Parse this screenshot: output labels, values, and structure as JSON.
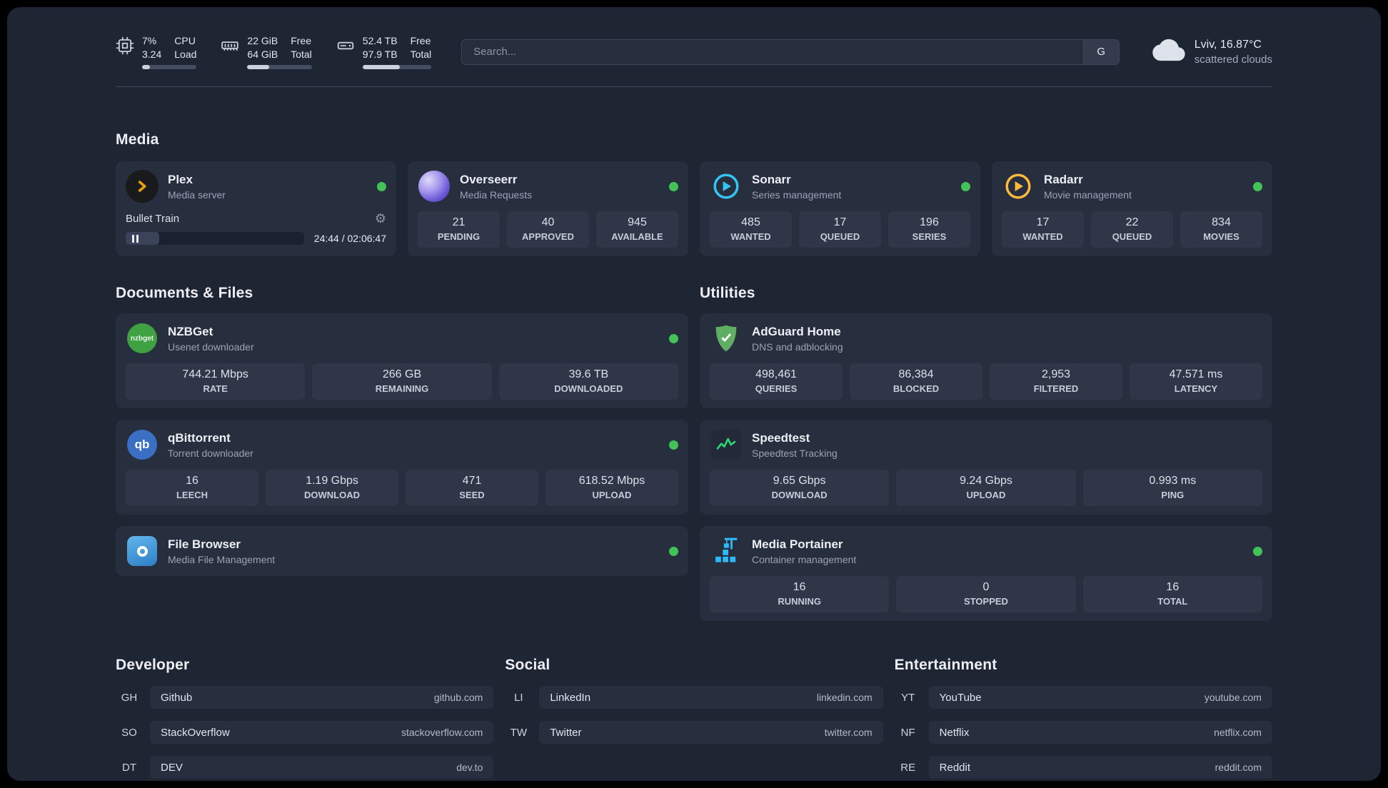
{
  "system": {
    "cpu": {
      "value1": "7%",
      "label1": "CPU",
      "value2": "3.24",
      "label2": "Load",
      "bar_style": "width:15%"
    },
    "ram": {
      "value1": "22 GiB",
      "label1": "Free",
      "value2": "64 GiB",
      "label2": "Total",
      "bar_style": "width:34%"
    },
    "disk": {
      "value1": "52.4 TB",
      "label1": "Free",
      "value2": "97.9 TB",
      "label2": "Total",
      "bar_style": "width:54%"
    }
  },
  "search": {
    "placeholder": "Search...",
    "engine": "G"
  },
  "weather": {
    "location": "Lviv, 16.87°C",
    "condition": "scattered clouds"
  },
  "sections": {
    "media": "Media",
    "documents": "Documents & Files",
    "utilities": "Utilities",
    "developer": "Developer",
    "social": "Social",
    "entertainment": "Entertainment"
  },
  "media": {
    "plex": {
      "name": "Plex",
      "subtitle": "Media server",
      "track": "Bullet Train",
      "time": "24:44 / 02:06:47",
      "seek_style": "width:19%"
    },
    "overseerr": {
      "name": "Overseerr",
      "subtitle": "Media Requests",
      "stats": [
        {
          "value": "21",
          "label": "PENDING"
        },
        {
          "value": "40",
          "label": "APPROVED"
        },
        {
          "value": "945",
          "label": "AVAILABLE"
        }
      ]
    },
    "sonarr": {
      "name": "Sonarr",
      "subtitle": "Series management",
      "stats": [
        {
          "value": "485",
          "label": "WANTED"
        },
        {
          "value": "17",
          "label": "QUEUED"
        },
        {
          "value": "196",
          "label": "SERIES"
        }
      ]
    },
    "radarr": {
      "name": "Radarr",
      "subtitle": "Movie management",
      "stats": [
        {
          "value": "17",
          "label": "WANTED"
        },
        {
          "value": "22",
          "label": "QUEUED"
        },
        {
          "value": "834",
          "label": "MOVIES"
        }
      ]
    }
  },
  "documents": {
    "nzbget": {
      "name": "NZBGet",
      "subtitle": "Usenet downloader",
      "stats": [
        {
          "value": "744.21 Mbps",
          "label": "RATE"
        },
        {
          "value": "266 GB",
          "label": "REMAINING"
        },
        {
          "value": "39.6 TB",
          "label": "DOWNLOADED"
        }
      ]
    },
    "qbittorrent": {
      "name": "qBittorrent",
      "subtitle": "Torrent downloader",
      "stats": [
        {
          "value": "16",
          "label": "LEECH"
        },
        {
          "value": "1.19 Gbps",
          "label": "DOWNLOAD"
        },
        {
          "value": "471",
          "label": "SEED"
        },
        {
          "value": "618.52 Mbps",
          "label": "UPLOAD"
        }
      ]
    },
    "filebrowser": {
      "name": "File Browser",
      "subtitle": "Media File Management"
    }
  },
  "utilities": {
    "adguard": {
      "name": "AdGuard Home",
      "subtitle": "DNS and adblocking",
      "stats": [
        {
          "value": "498,461",
          "label": "QUERIES"
        },
        {
          "value": "86,384",
          "label": "BLOCKED"
        },
        {
          "value": "2,953",
          "label": "FILTERED"
        },
        {
          "value": "47.571 ms",
          "label": "LATENCY"
        }
      ]
    },
    "speedtest": {
      "name": "Speedtest",
      "subtitle": "Speedtest Tracking",
      "stats": [
        {
          "value": "9.65 Gbps",
          "label": "DOWNLOAD"
        },
        {
          "value": "9.24 Gbps",
          "label": "UPLOAD"
        },
        {
          "value": "0.993 ms",
          "label": "PING"
        }
      ]
    },
    "portainer": {
      "name": "Media Portainer",
      "subtitle": "Container management",
      "stats": [
        {
          "value": "16",
          "label": "RUNNING"
        },
        {
          "value": "0",
          "label": "STOPPED"
        },
        {
          "value": "16",
          "label": "TOTAL"
        }
      ]
    }
  },
  "links": {
    "developer": [
      {
        "abbr": "GH",
        "name": "Github",
        "url": "github.com"
      },
      {
        "abbr": "SO",
        "name": "StackOverflow",
        "url": "stackoverflow.com"
      },
      {
        "abbr": "DT",
        "name": "DEV",
        "url": "dev.to"
      }
    ],
    "social": [
      {
        "abbr": "LI",
        "name": "LinkedIn",
        "url": "linkedin.com"
      },
      {
        "abbr": "TW",
        "name": "Twitter",
        "url": "twitter.com"
      }
    ],
    "entertainment": [
      {
        "abbr": "YT",
        "name": "YouTube",
        "url": "youtube.com"
      },
      {
        "abbr": "NF",
        "name": "Netflix",
        "url": "netflix.com"
      },
      {
        "abbr": "RE",
        "name": "Reddit",
        "url": "reddit.com"
      }
    ]
  },
  "icons": {
    "gear": "⚙",
    "nzbget_text": "nzbget",
    "qbittorrent_text": "qb"
  },
  "colors": {
    "status_green": "#42c257",
    "plex_amber": "#e5a00d",
    "overseerr_purple": "#6a58d6",
    "sonarr_blue": "#35c5f4",
    "radarr_yellow": "#ffb93d",
    "nzbget_green": "#3fa142",
    "qbittorrent_blue": "#3a6fc4",
    "filebrowser_blue": "#2d7fc4",
    "adguard_green": "#5fae63",
    "speedtest_green": "#2ed573",
    "portainer_blue": "#2fb9f7"
  }
}
